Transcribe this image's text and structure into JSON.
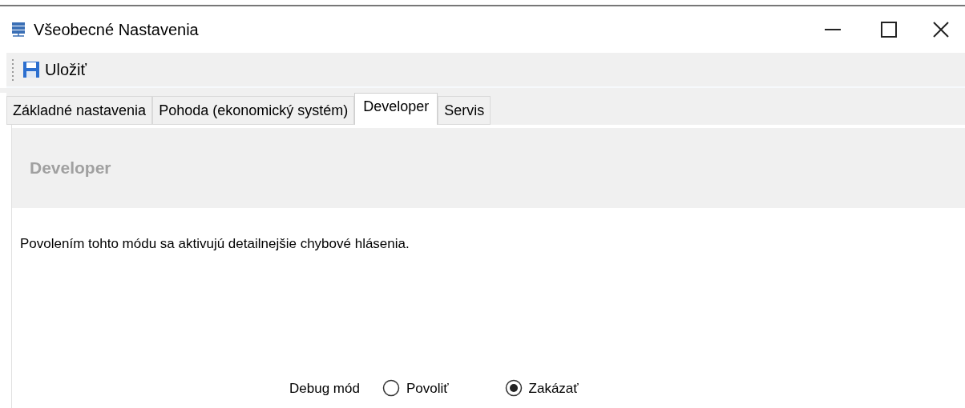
{
  "window": {
    "title": "Všeobecné Nastavenia"
  },
  "toolbar": {
    "save_label": "Uložiť"
  },
  "tabs": [
    {
      "label": "Základné nastavenia",
      "selected": false
    },
    {
      "label": "Pohoda (ekonomický systém)",
      "selected": false
    },
    {
      "label": "Developer",
      "selected": true
    },
    {
      "label": "Servis",
      "selected": false
    }
  ],
  "panel": {
    "heading": "Developer",
    "description": "Povolením tohto módu sa aktivujú detailnejšie chybové hlásenia."
  },
  "debug_mode": {
    "label": "Debug mód",
    "options": [
      {
        "label": "Povoliť",
        "selected": false
      },
      {
        "label": "Zakázať",
        "selected": true
      }
    ]
  }
}
